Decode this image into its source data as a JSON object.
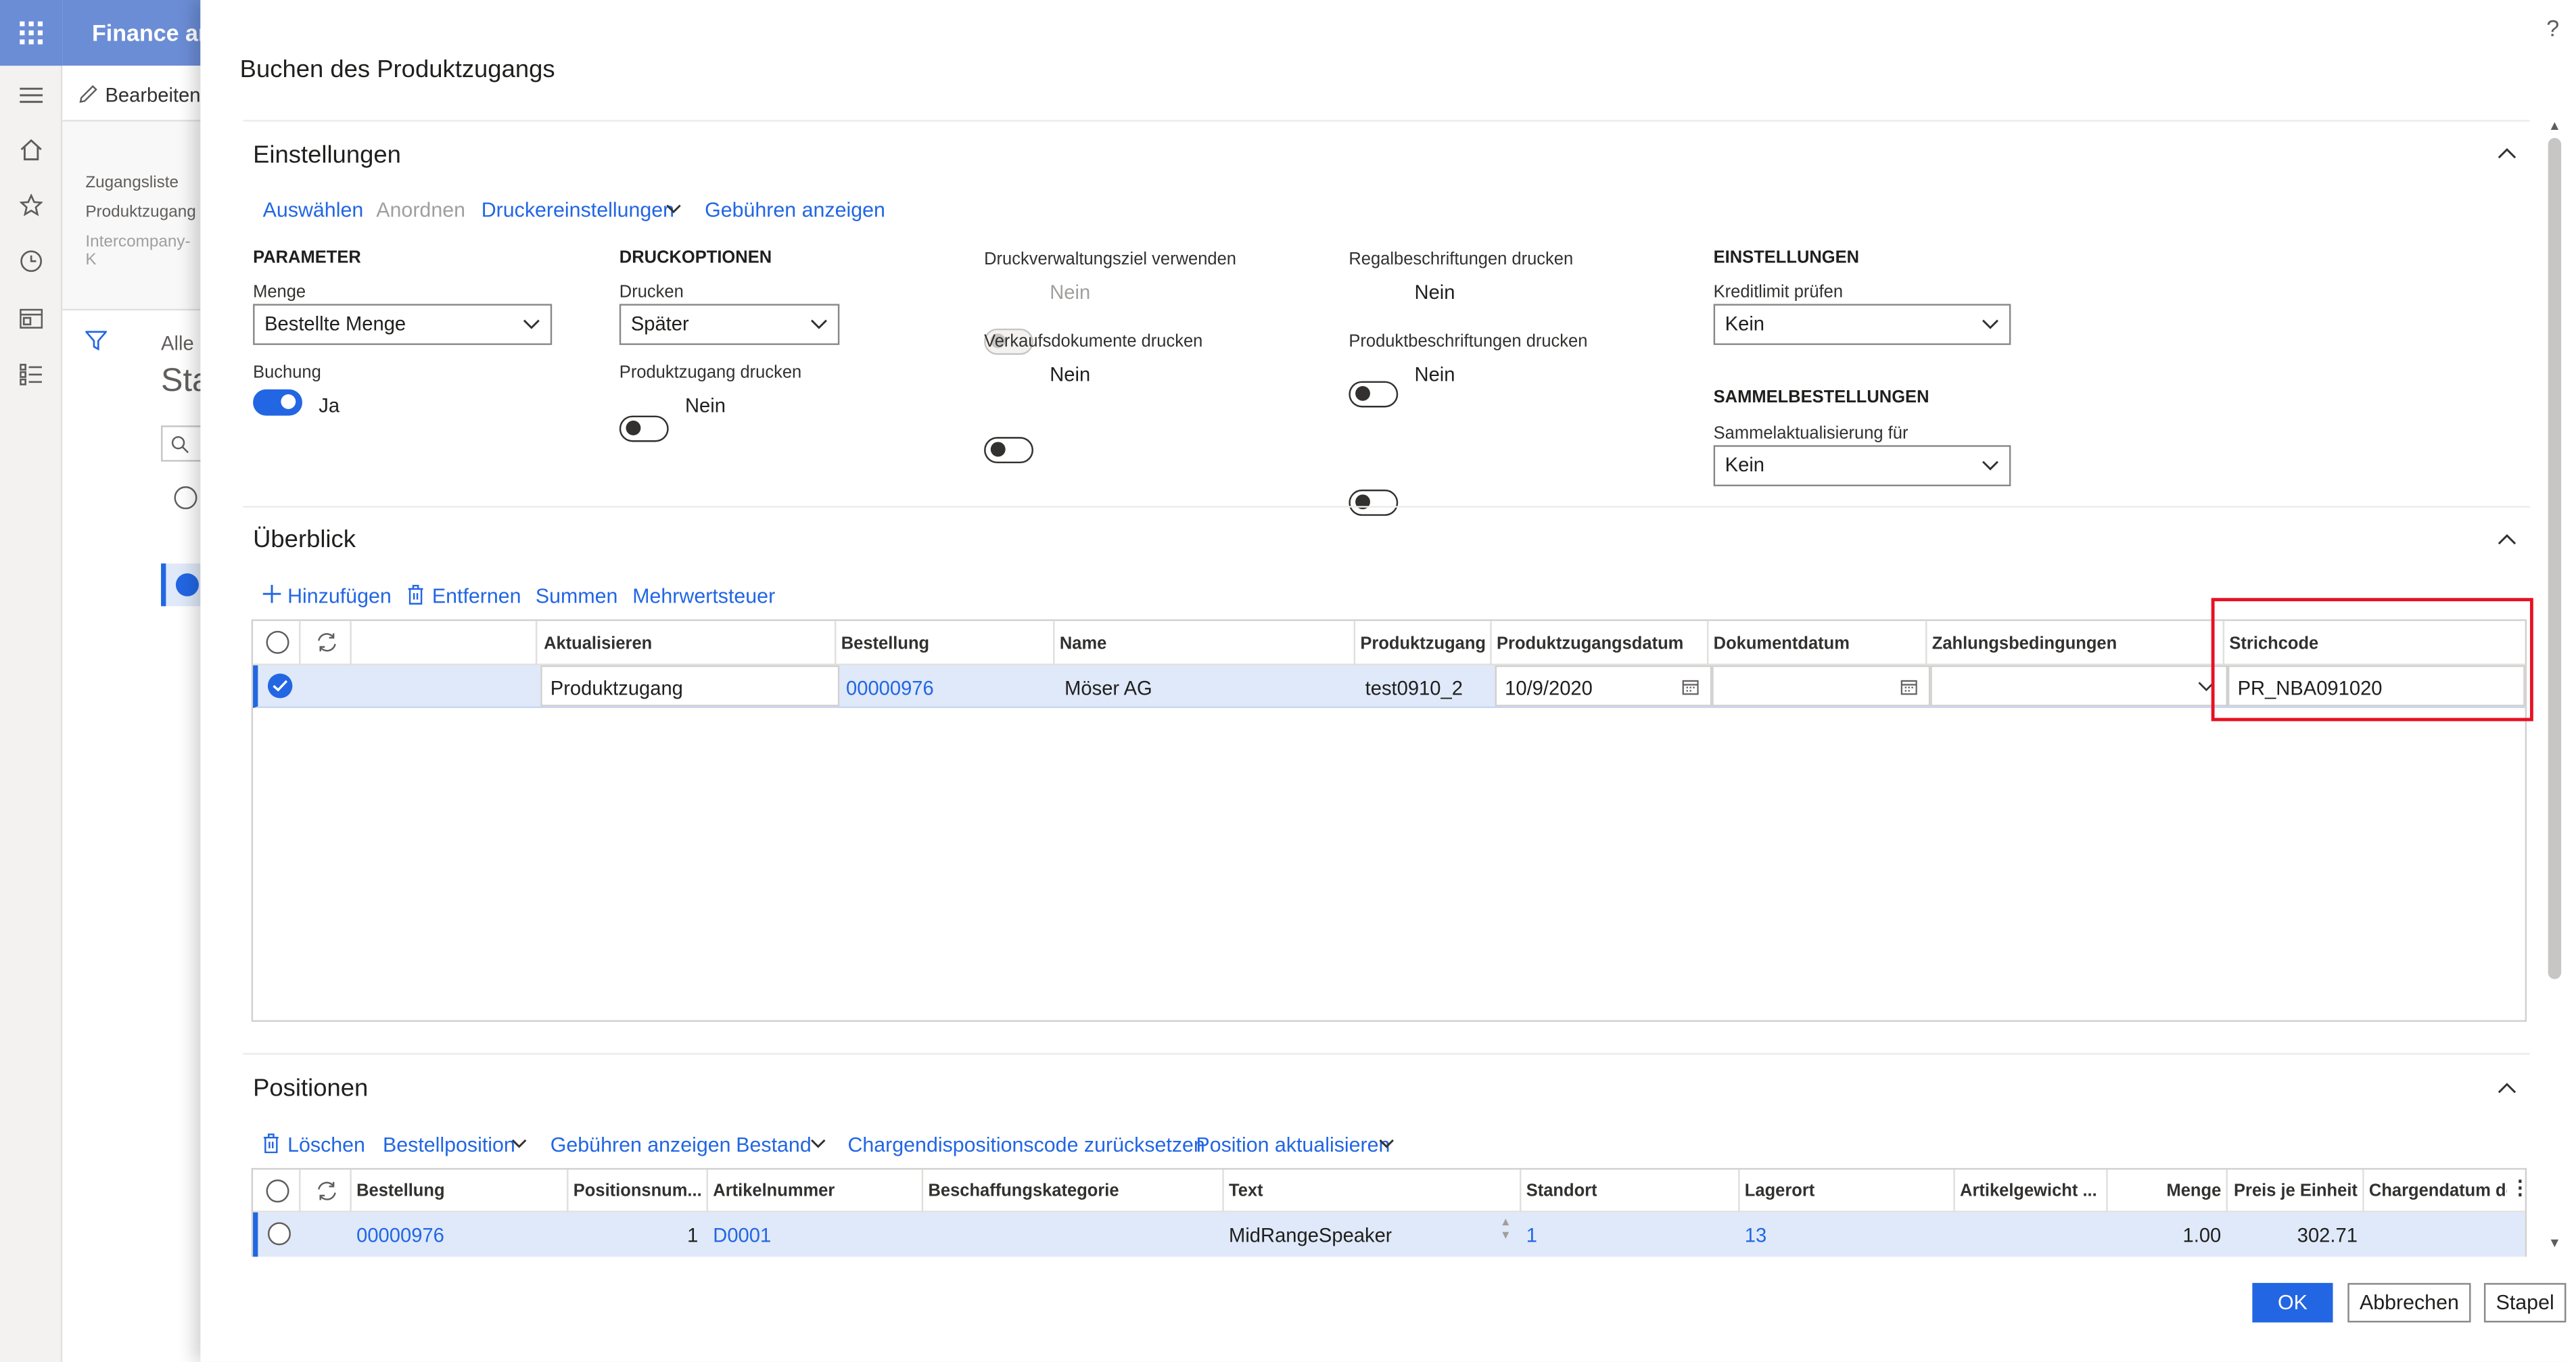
{
  "background": {
    "app_title": "Finance and Operations",
    "edit_label": "Bearbeiten",
    "nav_links": [
      "Zugangsliste",
      "Produktzugang",
      "Intercompany-K"
    ],
    "filter_text": "Alle",
    "page_heading": "Sta"
  },
  "dialog": {
    "title": "Buchen des Produktzugangs",
    "help": "?"
  },
  "einstellungen": {
    "title": "Einstellungen",
    "toolbar": {
      "select": "Auswählen",
      "arrange": "Anordnen",
      "printer": "Druckereinstellungen",
      "fees": "Gebühren anzeigen"
    },
    "parameter_header": "PARAMETER",
    "menge_label": "Menge",
    "menge_value": "Bestellte Menge",
    "buchung_label": "Buchung",
    "buchung_value": "Ja",
    "druckoptionen_header": "DRUCKOPTIONEN",
    "drucken_label": "Drucken",
    "drucken_value": "Später",
    "pz_drucken_label": "Produktzugang drucken",
    "pz_drucken_value": "Nein",
    "druckverwaltung_label": "Druckverwaltungsziel verwenden",
    "druckverwaltung_value": "Nein",
    "verkaufsdok_label": "Verkaufsdokumente drucken",
    "verkaufsdok_value": "Nein",
    "regal_label": "Regalbeschriftungen drucken",
    "regal_value": "Nein",
    "produktbeschr_label": "Produktbeschriftungen drucken",
    "produktbeschr_value": "Nein",
    "einst_header": "EINSTELLUNGEN",
    "kredit_label": "Kreditlimit prüfen",
    "kredit_value": "Kein",
    "sammel_header": "SAMMELBESTELLUNGEN",
    "sammelakt_label": "Sammelaktualisierung für",
    "sammelakt_value": "Kein"
  },
  "ueberblick": {
    "title": "Überblick",
    "toolbar": {
      "add": "Hinzufügen",
      "remove": "Entfernen",
      "totals": "Summen",
      "vat": "Mehrwertsteuer"
    },
    "columns": [
      "Aktualisieren",
      "Bestellung",
      "Name",
      "Produktzugang",
      "Produktzugangsdatum",
      "Dokumentdatum",
      "Zahlungsbedingungen",
      "Strichcode"
    ],
    "row": {
      "aktualisieren": "Produktzugang",
      "bestellung": "00000976",
      "name": "Möser AG",
      "produktzugang": "test0910_2",
      "datum": "10/9/2020",
      "dokumentdatum": "",
      "zahlungsbedingungen": "",
      "strichcode": "PR_NBA091020"
    }
  },
  "positionen": {
    "title": "Positionen",
    "toolbar": {
      "delete": "Löschen",
      "order_line": "Bestellposition",
      "fees": "Gebühren anzeigen",
      "stock": "Bestand",
      "batch_reset": "Chargendispositionscode zurücksetzen",
      "update_line": "Position aktualisieren"
    },
    "columns": [
      "Bestellung",
      "Positionsnum...",
      "Artikelnummer",
      "Beschaffungskategorie",
      "Text",
      "Standort",
      "Lagerort",
      "Artikelgewicht ...",
      "Menge",
      "Preis je Einheit",
      "Chargendatum de"
    ],
    "row": {
      "bestellung": "00000976",
      "positionsnummer": "1",
      "artikelnummer": "D0001",
      "beschaffungskategorie": "",
      "text": "MidRangeSpeaker",
      "standort": "1",
      "lagerort": "13",
      "artikelgewicht": "",
      "menge": "1.00",
      "preis": "302.71",
      "chargendatum": ""
    }
  },
  "footer": {
    "ok": "OK",
    "cancel": "Abbrechen",
    "batch": "Stapel"
  },
  "colors": {
    "accent": "#2266e3",
    "header_blue": "#6b8dd6",
    "selected_row": "#dfe9f9",
    "highlight_box": "#e81123"
  }
}
